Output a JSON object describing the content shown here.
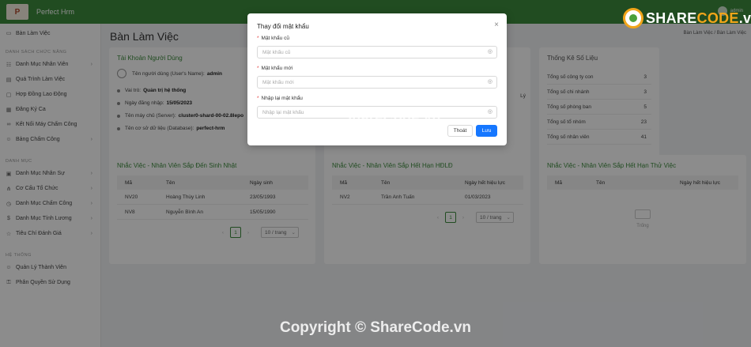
{
  "header": {
    "app_title": "Perfect Hrm",
    "logo_text": "P",
    "user": "admin"
  },
  "sidebar": {
    "top_item": "Bàn Làm Việc",
    "section1": "DANH SÁCH CHỨC NĂNG",
    "group1": [
      {
        "label": "Danh Mục Nhân Viên",
        "icon": "users-icon",
        "chevron": true
      },
      {
        "label": "Quá Trình Làm Việc",
        "icon": "file-icon",
        "chevron": false
      },
      {
        "label": "Hợp Đồng Lao Động",
        "icon": "document-icon",
        "chevron": false
      },
      {
        "label": "Đăng Ký Ca",
        "icon": "calendar-icon",
        "chevron": false
      },
      {
        "label": "Kết Nối Máy Chấm Công",
        "icon": "link-icon",
        "chevron": false
      },
      {
        "label": "Bảng Chấm Công",
        "icon": "people-icon",
        "chevron": true
      }
    ],
    "section2": "DANH MỤC",
    "group2": [
      {
        "label": "Danh Mục Nhân Sự",
        "icon": "folder-icon",
        "chevron": true
      },
      {
        "label": "Cơ Cấu Tổ Chức",
        "icon": "branch-icon",
        "chevron": true
      },
      {
        "label": "Danh Mục Chấm Công",
        "icon": "clock-icon",
        "chevron": true
      },
      {
        "label": "Danh Mục Tính Lương",
        "icon": "money-icon",
        "chevron": true
      },
      {
        "label": "Tiêu Chí Đánh Giá",
        "icon": "star-icon",
        "chevron": true
      }
    ],
    "section3": "HỆ THỐNG",
    "group3": [
      {
        "label": "Quản Lý Thành Viên",
        "icon": "user-icon",
        "chevron": false
      },
      {
        "label": "Phân Quyền Sử Dụng",
        "icon": "key-icon",
        "chevron": false
      }
    ]
  },
  "main": {
    "page_title": "Bàn Làm Việc",
    "breadcrumb": "Bàn Làm Việc  /  Bàn Làm Việc",
    "account": {
      "title": "Tài Khoản Người Dùng",
      "username_label": "Tên người dùng (User's Name):",
      "username_value": "admin",
      "role_label": "Vai trò:",
      "role_value": "Quản trị hệ thống",
      "login_label": "Ngày đăng nhập:",
      "login_value": "15/05/2023",
      "server_label": "Tên máy chủ (Server):",
      "server_value": "cluster0-shard-00-02.8lepo",
      "db_label": "Tên cơ sở dữ liệu (Database):",
      "db_value": "perfect-hrm"
    },
    "middle_card_fragment": "Lý",
    "stats": {
      "title": "Thống Kê Số Liệu",
      "rows": [
        {
          "label": "Tổng số công ty con",
          "value": "3"
        },
        {
          "label": "Tổng số chi nhánh",
          "value": "3"
        },
        {
          "label": "Tổng số phòng ban",
          "value": "5"
        },
        {
          "label": "Tổng số tổ nhóm",
          "value": "23"
        },
        {
          "label": "Tổng số nhân viên",
          "value": "41"
        }
      ]
    },
    "birthday": {
      "title": "Nhắc Việc - Nhân Viên Sắp Đến Sinh Nhật",
      "headers": [
        "Mã",
        "Tên",
        "Ngày sinh"
      ],
      "rows": [
        [
          "NV20",
          "Hoàng Thùy Linh",
          "23/05/1993"
        ],
        [
          "NV8",
          "Nguyễn Bình An",
          "15/05/1990"
        ]
      ],
      "page": "1",
      "page_size": "10 / trang"
    },
    "contract": {
      "title": "Nhắc Việc - Nhân Viên Sắp Hết Hạn HĐLĐ",
      "headers": [
        "Mã",
        "Tên",
        "Ngày hết hiệu lực"
      ],
      "rows": [
        [
          "NV2",
          "Trần Anh Tuấn",
          "01/03/2023"
        ]
      ],
      "page": "1",
      "page_size": "10 / trang"
    },
    "probation": {
      "title": "Nhắc Việc - Nhân Viên Sắp Hết Hạn Thử Việc",
      "headers": [
        "Mã",
        "Tên",
        "Ngày hết hiệu lực"
      ],
      "empty_text": "Trống"
    }
  },
  "modal": {
    "title": "Thay đổi mật khẩu",
    "fields": [
      {
        "label": "Mật khẩu cũ",
        "placeholder": "Mật khẩu cũ"
      },
      {
        "label": "Mật khẩu mới",
        "placeholder": "Mật khẩu mới"
      },
      {
        "label": "Nhập lại mật khẩu",
        "placeholder": "Nhập lại mật khẩu"
      }
    ],
    "cancel_label": "Thoát",
    "save_label": "Lưu"
  },
  "watermark": {
    "center": "ShareCode.vn",
    "bottom": "Copyright © ShareCode.vn",
    "logo_pre": "SHARE",
    "logo_o": "CODE",
    "logo_suf": ".vn"
  },
  "colors": {
    "primary_green": "#3d8a3d",
    "button_blue": "#1677ff",
    "required_red": "#e23d3d"
  }
}
